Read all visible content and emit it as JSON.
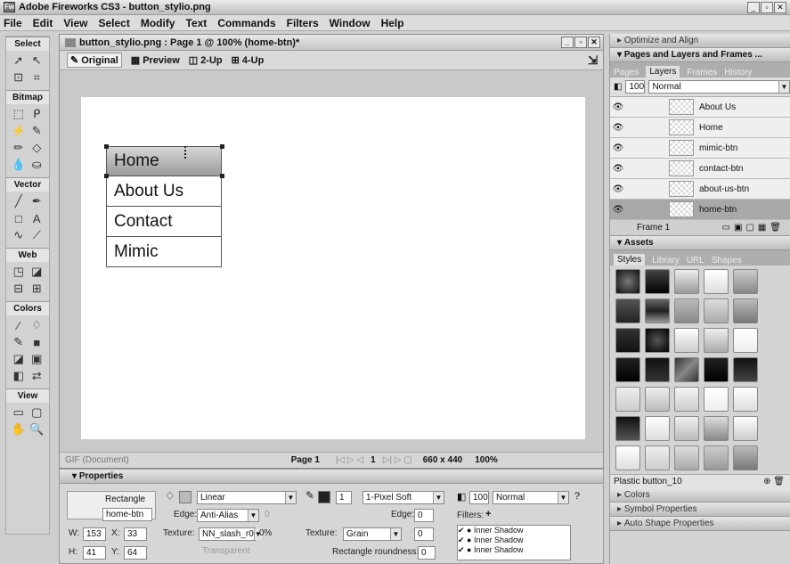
{
  "app": {
    "title": "Adobe Fireworks CS3 - button_stylio.png"
  },
  "menu": [
    "File",
    "Edit",
    "View",
    "Select",
    "Modify",
    "Text",
    "Commands",
    "Filters",
    "Window",
    "Help"
  ],
  "tools": {
    "sections": [
      "Select",
      "Bitmap",
      "Vector",
      "Web",
      "Colors",
      "View"
    ]
  },
  "document": {
    "title": "button_stylio.png : Page 1 @ 100% (home-btn)*",
    "views": [
      "Original",
      "Preview",
      "2-Up",
      "4-Up"
    ],
    "buttons": [
      "Home",
      "About Us",
      "Contact",
      "Mimic"
    ],
    "status": {
      "format": "GIF (Document)",
      "page": "Page 1",
      "frame": "1",
      "size": "660 x 440",
      "zoom": "100%"
    }
  },
  "panels": {
    "optimize": "Optimize and Align",
    "pages_layers": "Pages and Layers and Frames ...",
    "pl_tabs": [
      "Pages",
      "Layers",
      "Frames",
      "History"
    ],
    "opacity": "100",
    "blend": "Normal",
    "layers": [
      {
        "name": "About Us",
        "selected": false
      },
      {
        "name": "Home",
        "selected": false
      },
      {
        "name": "mimic-btn",
        "selected": false
      },
      {
        "name": "contact-btn",
        "selected": false
      },
      {
        "name": "about-us-btn",
        "selected": false
      },
      {
        "name": "home-btn",
        "selected": true
      }
    ],
    "frame_label": "Frame 1",
    "assets": "Assets",
    "asset_tabs": [
      "Styles",
      "Library",
      "URL",
      "Shapes"
    ],
    "style_name": "Plastic button_10",
    "collapsed": [
      "Colors",
      "Symbol Properties",
      "Auto Shape Properties"
    ]
  },
  "properties": {
    "header": "Properties",
    "shape": "Rectangle",
    "name": "home-btn",
    "fill_type": "Linear",
    "edge_label": "Edge:",
    "edge": "Anti-Alias",
    "edge_value": "0",
    "texture_label": "Texture:",
    "texture": "NN_slash_r0",
    "texture_pct": "0%",
    "transparent": "Transparent",
    "w_label": "W:",
    "w": "153",
    "h_label": "H:",
    "h": "41",
    "x_label": "X:",
    "x": "33",
    "y_label": "Y:",
    "y": "64",
    "stroke_width": "1",
    "stroke_type": "1-Pixel Soft",
    "stroke_edge_label": "Edge:",
    "stroke_edge": "0",
    "stroke_texture_label": "Texture:",
    "stroke_texture": "Grain",
    "stroke_texture_value": "0",
    "roundness_label": "Rectangle roundness:",
    "roundness": "0",
    "opacity": "100",
    "blend": "Normal",
    "filters_label": "Filters:",
    "filters": [
      "Inner Shadow",
      "Inner Shadow",
      "Inner Shadow"
    ]
  }
}
